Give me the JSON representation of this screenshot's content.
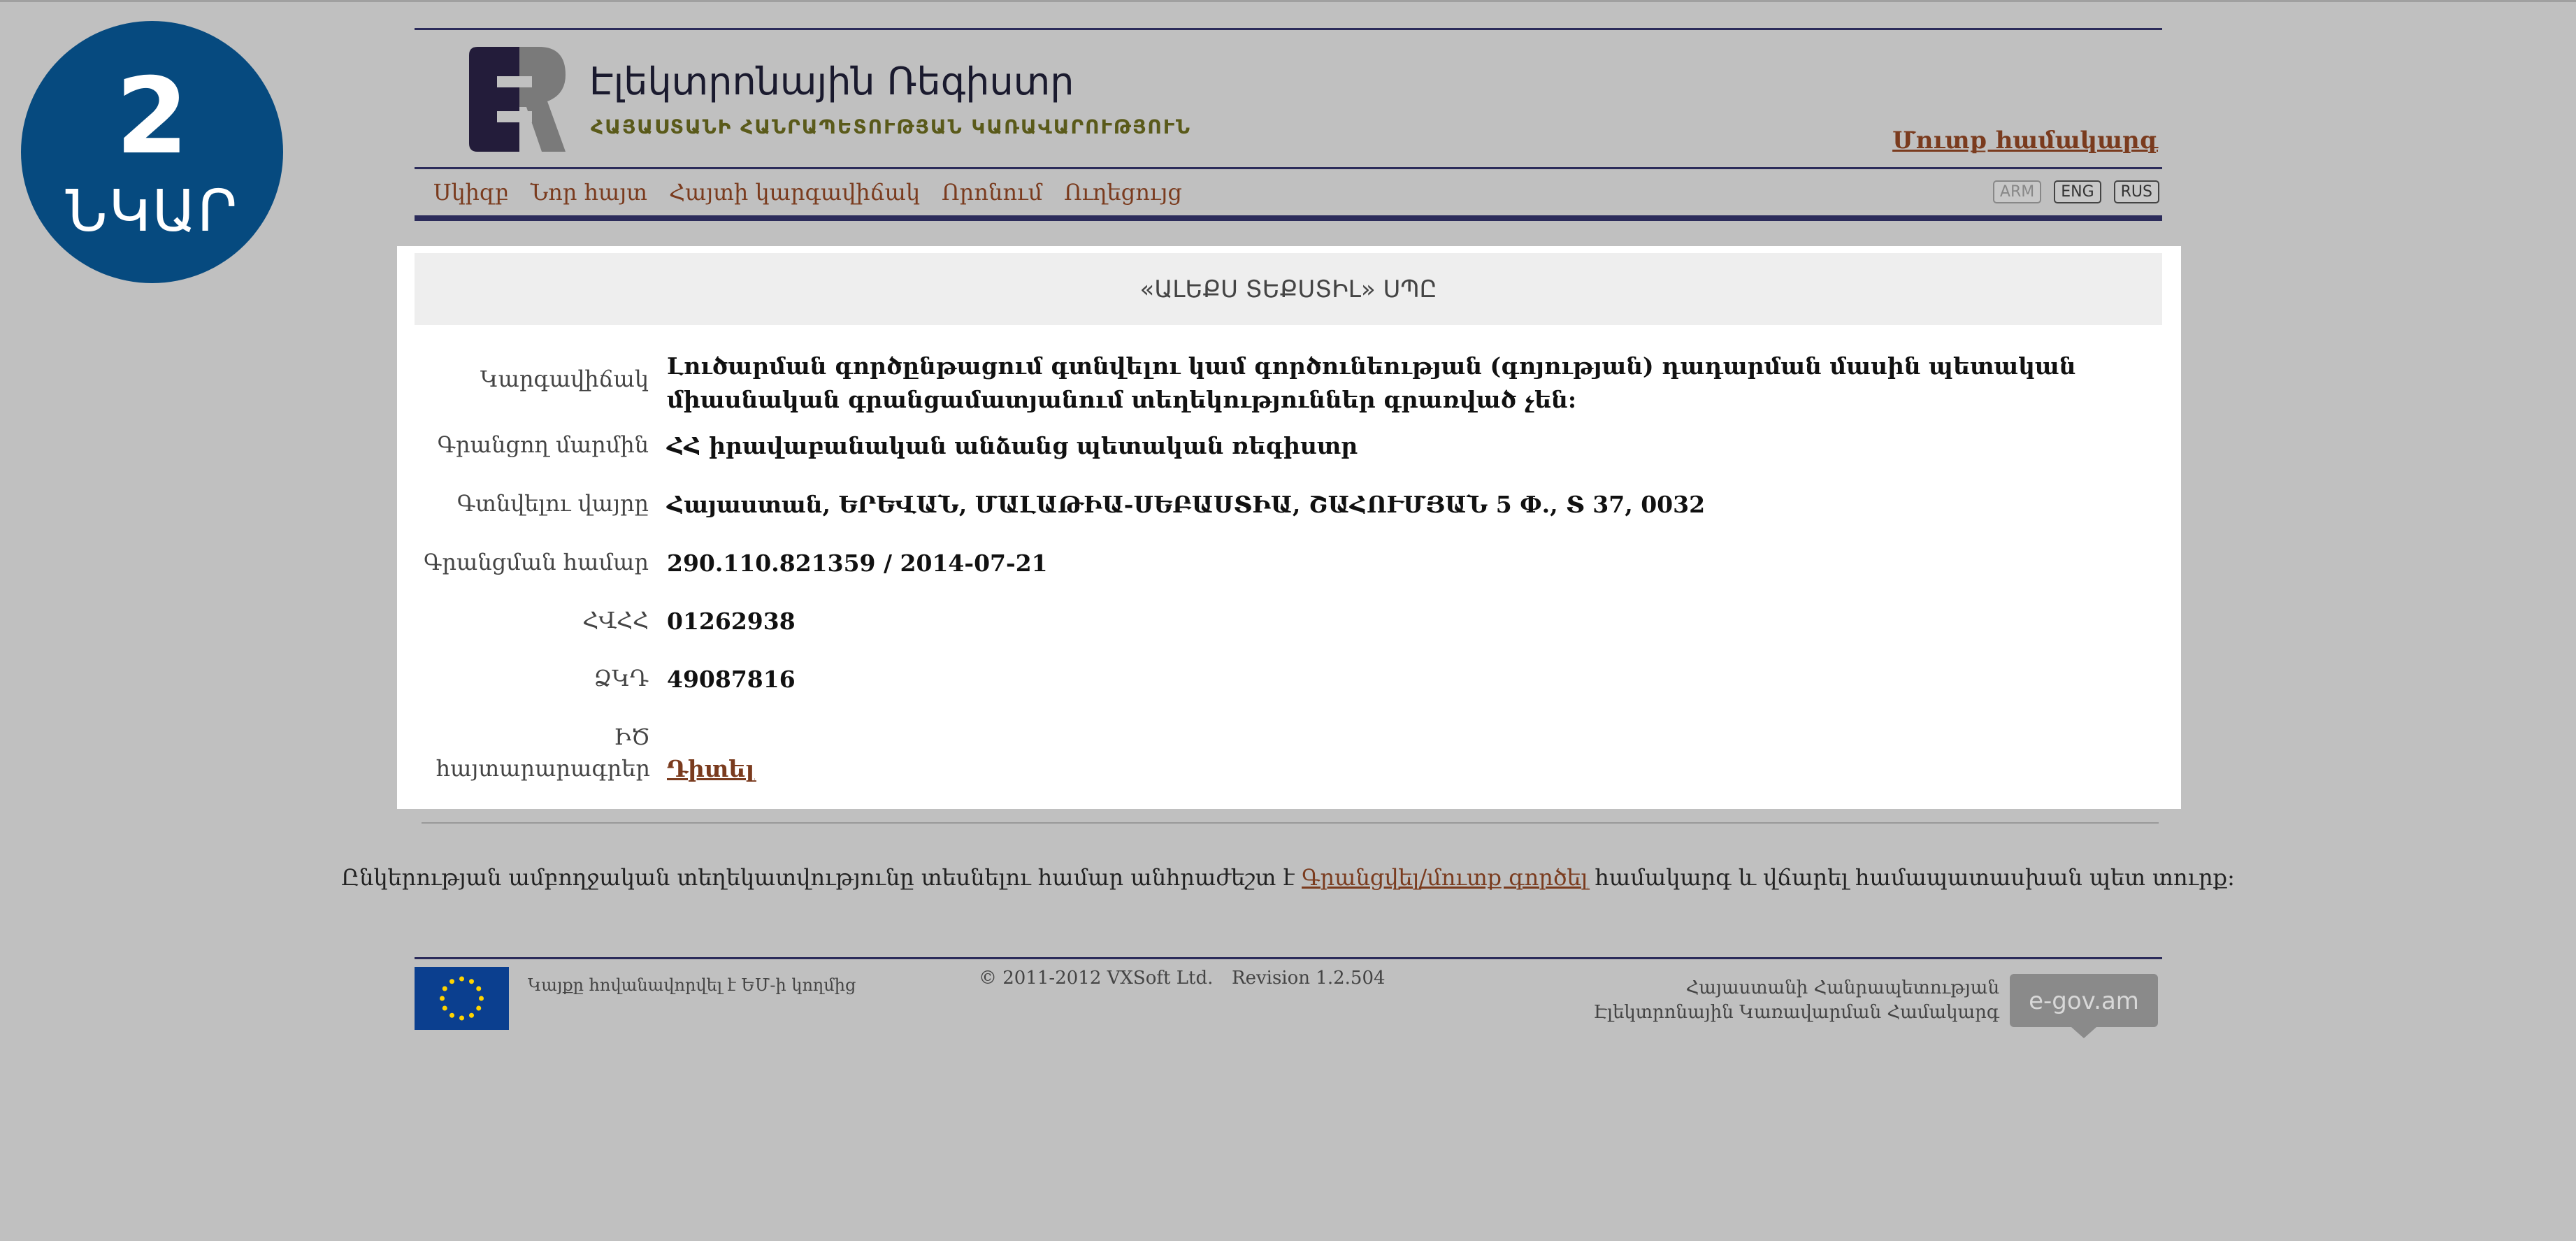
{
  "badge": {
    "number": "2",
    "word": "ՆԿԱՐ"
  },
  "header": {
    "title": "Էլեկտրոնային Ռեգիստր",
    "subtitle": "ՀԱՅԱՍՏԱՆԻ ՀԱՆՐԱՊԵՏՈՒԹՅԱՆ ԿԱՌԱՎԱՐՈՒԹՅՈՒՆ",
    "login_link": "Մուտք համակարգ"
  },
  "nav": {
    "items": [
      "Սկիզբ",
      "Նոր հայտ",
      "Հայտի կարգավիճակ",
      "Որոնում",
      "Ուղեցույց"
    ],
    "languages": [
      "ARM",
      "ENG",
      "RUS"
    ],
    "active_language": "ARM"
  },
  "company": {
    "title": "«ԱԼԵՔՍ ՏԵՔՍՏԻԼ» ՍՊԸ",
    "fields": [
      {
        "label": "Կարգավիճակ",
        "value": "Լուծարման գործընթացում գտնվելու կամ գործունեության (գոյության) դադարման մասին պետական միասնական գրանցամատյանում տեղեկություններ գրառված չեն:"
      },
      {
        "label": "Գրանցող մարմին",
        "value": "ՀՀ իրավաբանական անձանց պետական ռեգիստր"
      },
      {
        "label": "Գտնվելու վայրը",
        "value": "Հայաստան, ԵՐԵՎԱՆ, ՄԱԼԱԹԻԱ-ՍԵԲԱՍՏԻԱ, ՇԱՀՈՒՄՅԱՆ 5 Փ., Տ 37, 0032"
      },
      {
        "label": "Գրանցման համար",
        "value": "290.110.821359 / 2014-07-21"
      },
      {
        "label": "ՀՎՀՀ",
        "value": "01262938"
      },
      {
        "label": "ՁԿԴ",
        "value": "49087816"
      },
      {
        "label": "ԻԾ հայտարարագրեր",
        "value": "Դիտել"
      }
    ]
  },
  "notice": {
    "before": "Ընկերության ամբողջական տեղեկատվությունը տեսնելու համար անհրաժեշտ է ",
    "link": "Գրանցվել/մուտք գործել",
    "after": " համակարգ և վճարել համապատասխան պետ տուրք:"
  },
  "footer": {
    "eu_text": "Կայքը հովանավորվել է ԵՄ-ի կողմից",
    "copyright": "© 2011-2012 VXSoft Ltd.",
    "revision": "Revision 1.2.504",
    "gov_line1": "Հայաստանի Հանրապետության",
    "gov_line2": "Էլեկտրոնային Կառավարման Համակարգ",
    "egov_logo": "e-gov.am"
  },
  "colors": {
    "badge": "#064a7f",
    "link": "#7a3b1e",
    "rule": "#2b2b5a",
    "background": "#c0c0c0"
  }
}
